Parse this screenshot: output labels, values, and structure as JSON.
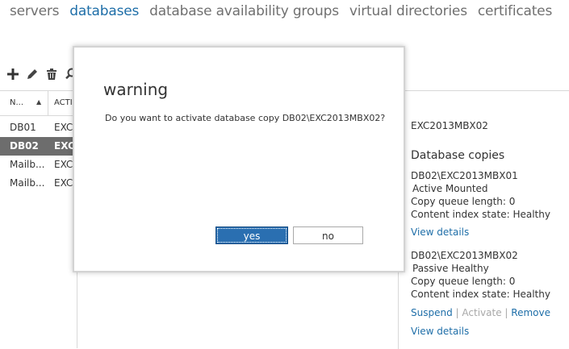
{
  "nav": {
    "items": [
      {
        "label": "servers",
        "active": false
      },
      {
        "label": "databases",
        "active": true
      },
      {
        "label": "database availability groups",
        "active": false
      },
      {
        "label": "virtual directories",
        "active": false
      },
      {
        "label": "certificates",
        "active": false
      }
    ]
  },
  "toolbar": {
    "icons": [
      "add-icon",
      "edit-icon",
      "delete-icon",
      "search-icon"
    ]
  },
  "grid": {
    "columns": [
      "N...",
      "ACTI"
    ],
    "rows": [
      {
        "name": "DB01",
        "server": "EXC"
      },
      {
        "name": "DB02",
        "server": "EXC"
      },
      {
        "name": "Mailb...",
        "server": "EXC"
      },
      {
        "name": "Mailb...",
        "server": "EXC"
      }
    ]
  },
  "details": {
    "server": "EXC2013MBX02",
    "copies_header": "Database copies",
    "copy1": {
      "name": "DB02\\EXC2013MBX01",
      "status": "Active Mounted",
      "queue": "Copy queue length:  0",
      "index": "Content index state:  Healthy",
      "view_details": "View details"
    },
    "copy2": {
      "name": "DB02\\EXC2013MBX02",
      "status": "Passive Healthy",
      "queue": "Copy queue length:  0",
      "index": "Content index state:  Healthy",
      "suspend": "Suspend",
      "activate": "Activate",
      "remove": "Remove",
      "separator": "|",
      "view_details": "View details"
    }
  },
  "dialog": {
    "title": "warning",
    "message": "Do you want to activate database copy DB02\\EXC2013MBX02?",
    "yes_label": "yes",
    "no_label": "no"
  },
  "colors": {
    "accent": "#1e6ea8",
    "selected_row": "#6d6d6d",
    "primary_button": "#2a6fb1"
  }
}
